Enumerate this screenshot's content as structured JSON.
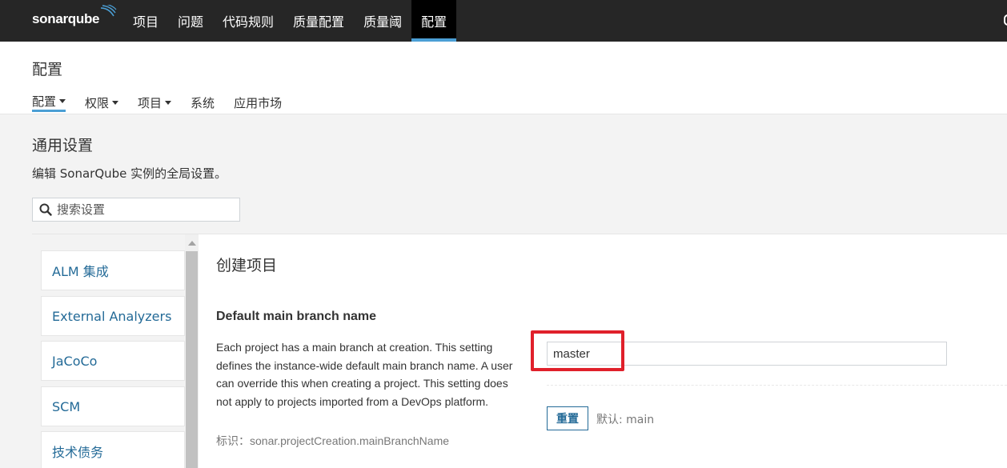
{
  "app": {
    "logo_text": "sonarqube"
  },
  "topnav": {
    "items": [
      {
        "label": "项目"
      },
      {
        "label": "问题"
      },
      {
        "label": "代码规则"
      },
      {
        "label": "质量配置"
      },
      {
        "label": "质量阈"
      },
      {
        "label": "配置",
        "active": true
      }
    ]
  },
  "page": {
    "title": "配置",
    "subnav": [
      {
        "label": "配置",
        "dropdown": true,
        "active": true
      },
      {
        "label": "权限",
        "dropdown": true
      },
      {
        "label": "项目",
        "dropdown": true
      },
      {
        "label": "系统",
        "dropdown": false
      },
      {
        "label": "应用市场",
        "dropdown": false
      }
    ]
  },
  "section": {
    "title": "通用设置",
    "description": "编辑 SonarQube 实例的全局设置。",
    "search_placeholder": "搜索设置"
  },
  "categories": [
    {
      "label": "ALM 集成"
    },
    {
      "label": "External Analyzers"
    },
    {
      "label": "JaCoCo"
    },
    {
      "label": "SCM"
    },
    {
      "label": "技术债务"
    }
  ],
  "main": {
    "category_title": "创建项目",
    "setting": {
      "name": "Default main branch name",
      "description": "Each project has a main branch at creation. This setting defines the instance-wide default main branch name. A user can override this when creating a project. This setting does not apply to projects imported from a DevOps platform.",
      "key_text": "标识：sonar.projectCreation.mainBranchName",
      "value": "master",
      "reset_label": "重置",
      "default_text": "默认: main"
    }
  },
  "colors": {
    "topbar": "#262626",
    "accent": "#4b9fd5",
    "link": "#236a97",
    "highlight": "#e0202b"
  }
}
